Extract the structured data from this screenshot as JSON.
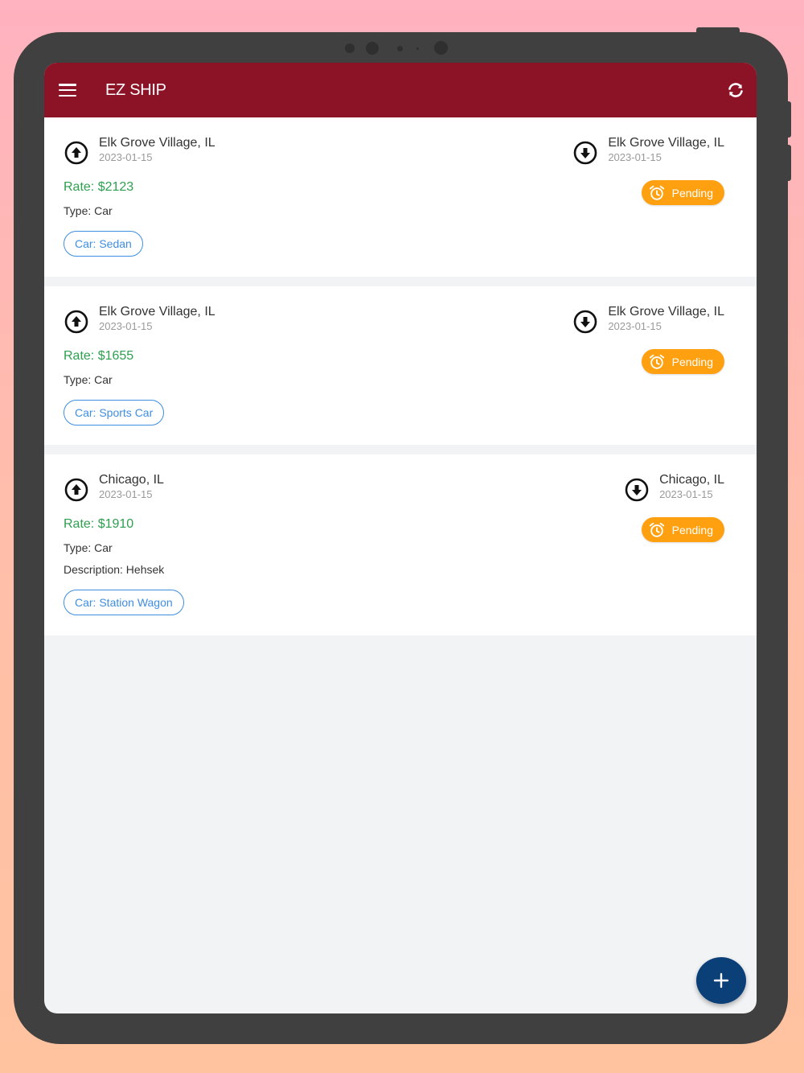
{
  "app": {
    "title": "EZ SHIP",
    "colors": {
      "appbar": "#8c1226",
      "rate": "#2e9e4f",
      "pending": "#ffa010",
      "chip": "#3f8ee0",
      "fab": "#0a3f77"
    },
    "icons": {
      "menu": "menu-icon",
      "refresh": "refresh-icon",
      "pickup": "arrow-up-circle-icon",
      "dropoff": "arrow-down-circle-icon",
      "status": "alarm-clock-icon",
      "add": "plus-icon"
    }
  },
  "shipments": [
    {
      "pickup": {
        "city": "Elk Grove Village, IL",
        "date": "2023-01-15"
      },
      "dropoff": {
        "city": "Elk Grove Village, IL",
        "date": "2023-01-15"
      },
      "rate": "Rate: $2123",
      "type": "Type: Car",
      "status": "Pending",
      "chip": "Car: Sedan"
    },
    {
      "pickup": {
        "city": "Elk Grove Village, IL",
        "date": "2023-01-15"
      },
      "dropoff": {
        "city": "Elk Grove Village, IL",
        "date": "2023-01-15"
      },
      "rate": "Rate: $1655",
      "type": "Type: Car",
      "status": "Pending",
      "chip": "Car: Sports Car"
    },
    {
      "pickup": {
        "city": "Chicago, IL",
        "date": "2023-01-15"
      },
      "dropoff": {
        "city": "Chicago, IL",
        "date": "2023-01-15"
      },
      "rate": "Rate: $1910",
      "type": "Type: Car",
      "description": "Description: Hehsek",
      "status": "Pending",
      "chip": "Car: Station Wagon"
    }
  ]
}
